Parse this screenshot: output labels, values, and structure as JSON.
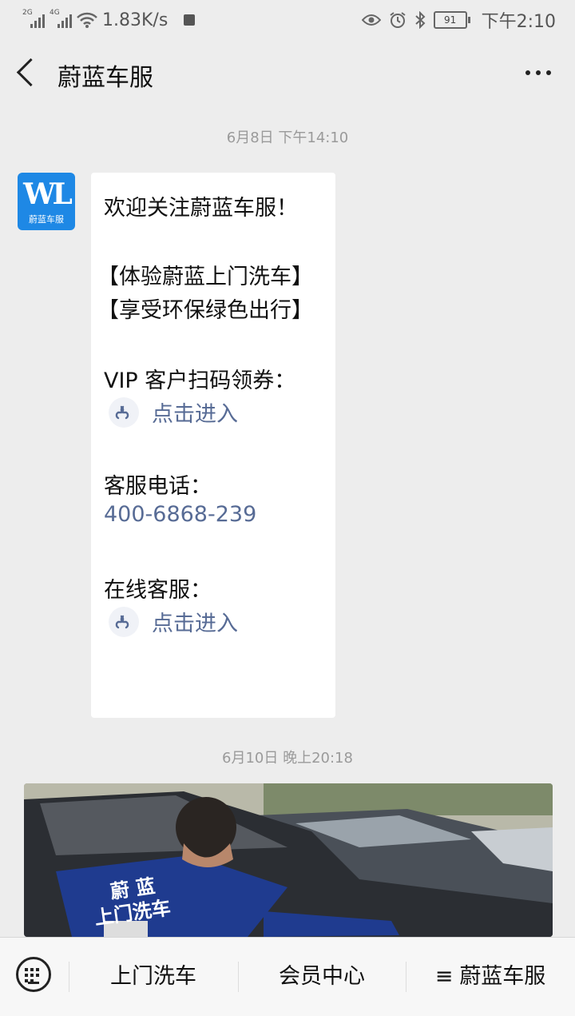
{
  "status_bar": {
    "signal1_tag": "2G",
    "signal2_tag": "4G",
    "speed": "1.83K/s",
    "battery": "91",
    "time": "下午2:10"
  },
  "nav": {
    "title": "蔚蓝车服"
  },
  "chat": {
    "timestamp1": "6月8日 下午14:10",
    "avatar_logo": "WL",
    "avatar_sub": "蔚蓝车服",
    "message": {
      "line1": "欢迎关注蔚蓝车服！",
      "line2": "【体验蔚蓝上门洗车】",
      "line3": "【享受环保绿色出行】",
      "line4": "VIP 客户扫码领券：",
      "link1": "点击进入",
      "line5": "客服电话：",
      "phone": "400-6868-239",
      "line6": "在线客服：",
      "link2": "点击进入"
    },
    "timestamp2": "6月10日 晚上20:18",
    "photo_text_line1": "蔚 蓝",
    "photo_text_line2": "上门洗车"
  },
  "bottom_menu": {
    "item1": "上门洗车",
    "item2": "会员中心",
    "item3_icon": "≡",
    "item3": "蔚蓝车服"
  },
  "colors": {
    "background": "#ededed",
    "link": "#576b95",
    "avatar": "#1e88e5"
  }
}
